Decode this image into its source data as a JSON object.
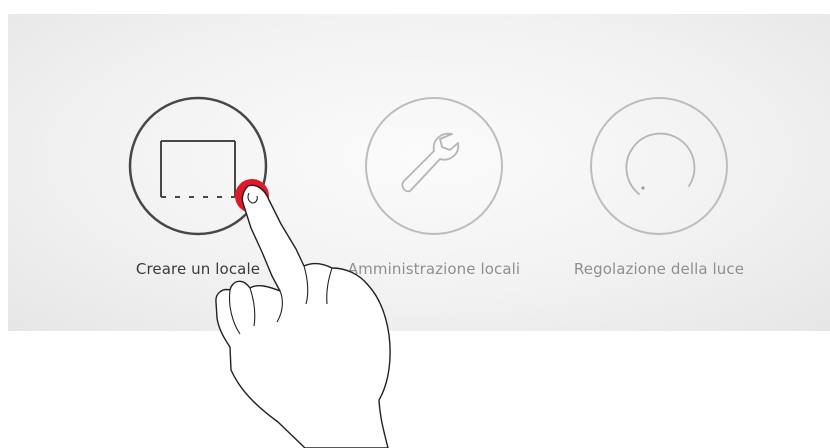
{
  "menu": {
    "items": [
      {
        "label": "Creare un locale",
        "icon": "room-frame-icon",
        "state": "selected"
      },
      {
        "label": "Amministrazione locali",
        "icon": "wrench-icon",
        "state": "inactive"
      },
      {
        "label": "Regolazione della luce",
        "icon": "dimmer-dial-icon",
        "state": "inactive"
      }
    ]
  },
  "colors": {
    "active_outline": "#444444",
    "inactive_outline": "#b8b8b8",
    "touch_point": "#e0182a"
  }
}
